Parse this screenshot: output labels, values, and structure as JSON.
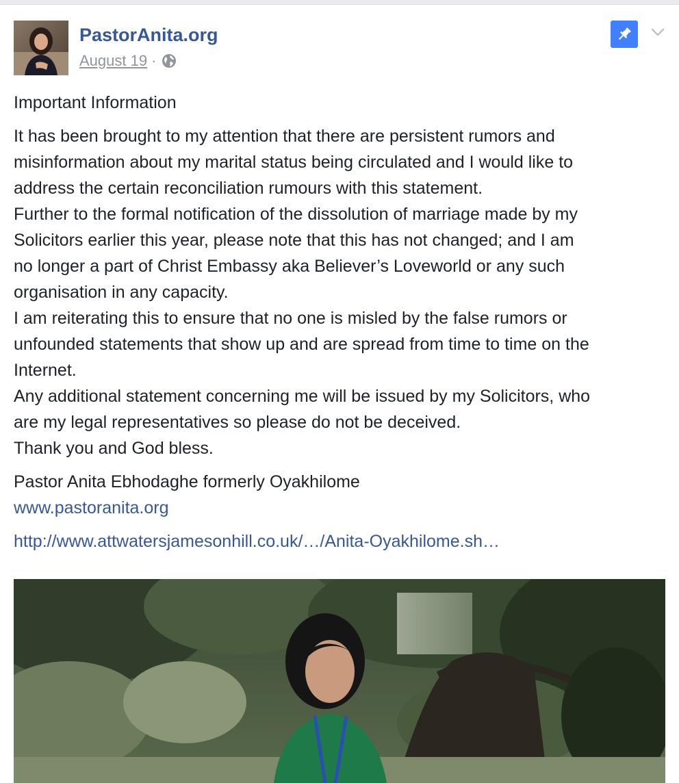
{
  "post": {
    "page_name": "PastorAnita.org",
    "date": "August 19",
    "separator": "·",
    "privacy_icon": "globe-icon",
    "pin_icon": "pin-icon",
    "menu_icon": "chevron-down-icon",
    "heading": "Important Information",
    "lines": [
      "It has been brought to my attention that there are persistent rumors and",
      "misinformation about my marital status being circulated and I would like to",
      "address the certain reconciliation rumours with this statement.",
      "Further to the formal notification of the dissolution of marriage made by my",
      "Solicitors earlier this year, please note that this has not changed; and I am",
      "no longer a part of Christ Embassy aka Believer’s Loveworld or any such",
      "organisation in any capacity.",
      "I am reiterating this to ensure that no one is misled by the false rumors or",
      "unfounded statements that show up and are spread from time to time on the",
      "Internet.",
      "Any additional statement concerning me will be issued by my Solicitors, who",
      "are my legal representatives so please do not be deceived.",
      "Thank you and God bless."
    ],
    "signature": "Pastor Anita Ebhodaghe formerly Oyakhilome",
    "website_link": "www.pastoranita.org",
    "external_link": "http://www.attwatersjamesonhill.co.uk/…/Anita-Oyakhilome.sh…"
  },
  "colors": {
    "link": "#365899",
    "text": "#1d2129",
    "meta": "#90949c",
    "pin_bg": "#4080ff"
  }
}
